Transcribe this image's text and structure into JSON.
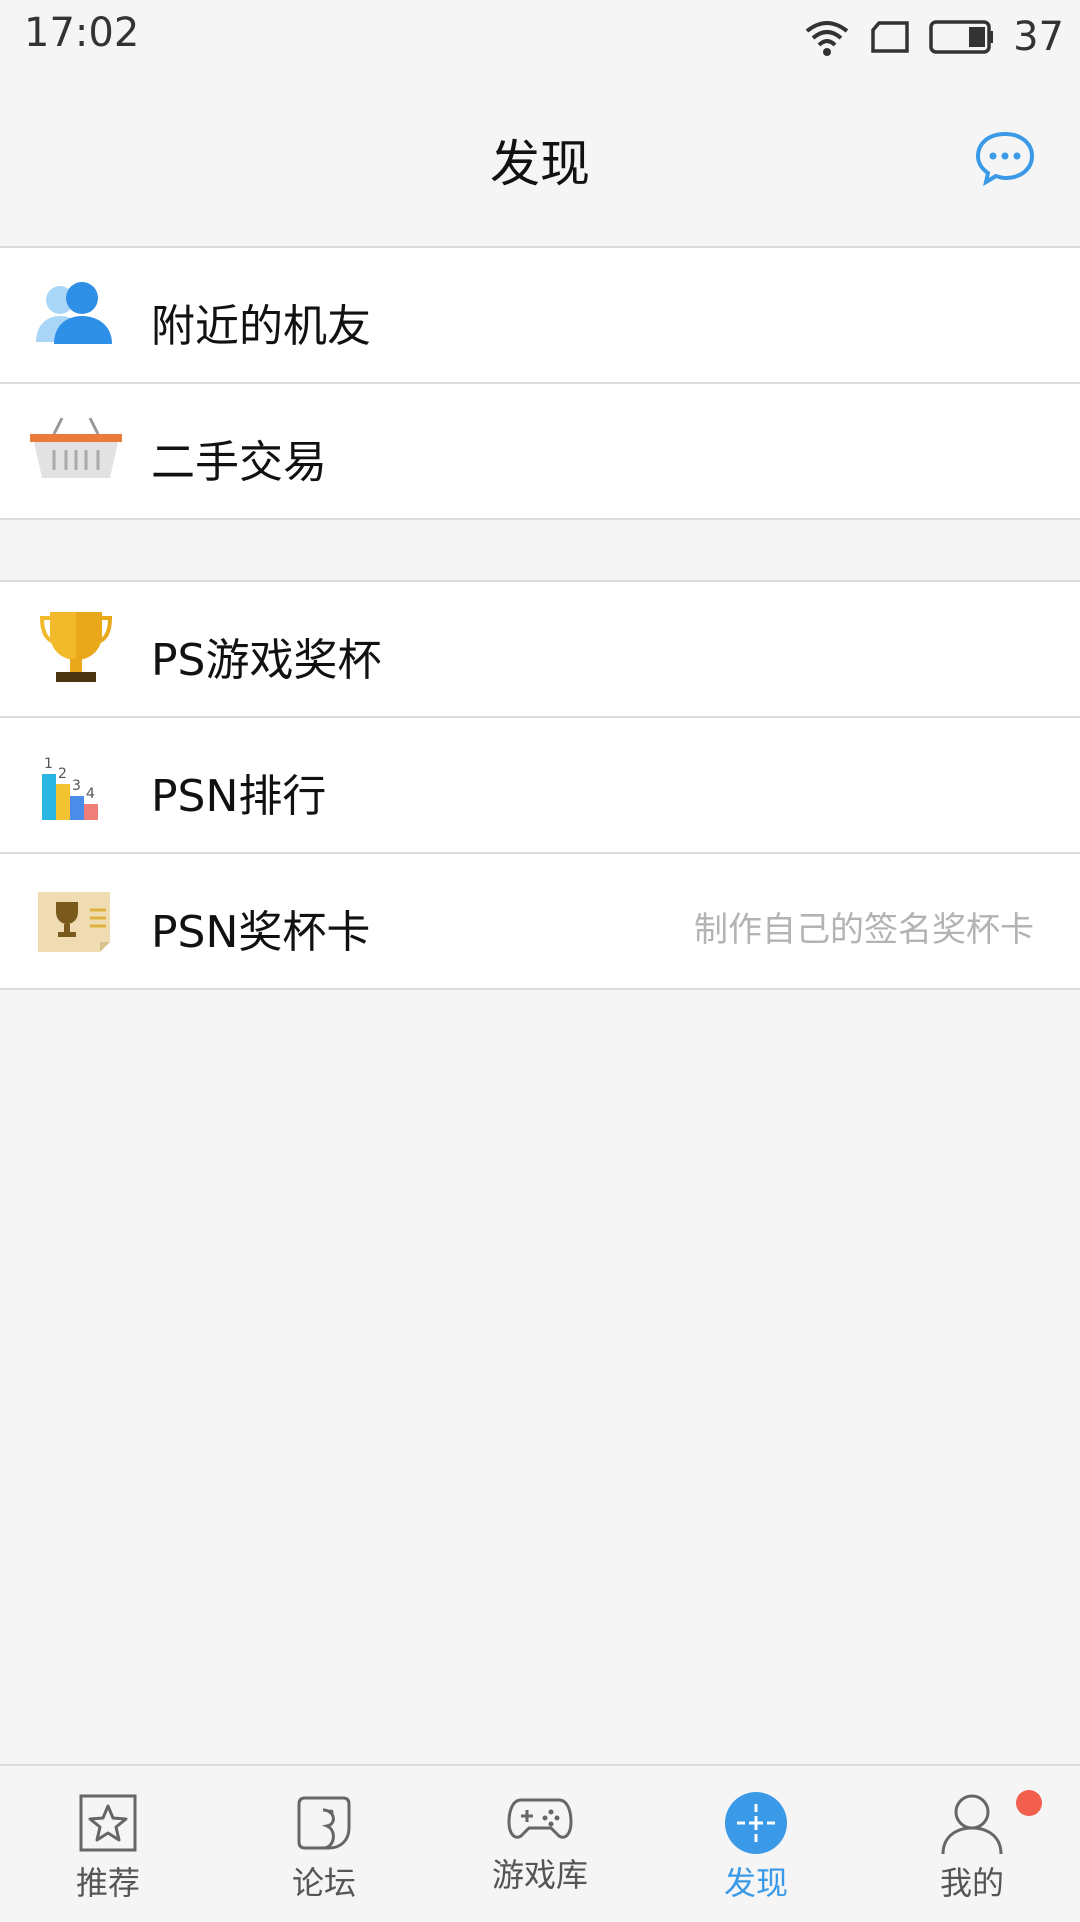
{
  "status": {
    "time": "17:02",
    "battery": "37"
  },
  "header": {
    "title": "发现"
  },
  "sections": [
    {
      "items": [
        {
          "label": "附近的机友",
          "icon": "people-icon"
        },
        {
          "label": "二手交易",
          "icon": "basket-icon"
        }
      ]
    },
    {
      "items": [
        {
          "label": "PS游戏奖杯",
          "icon": "trophy-icon"
        },
        {
          "label": "PSN排行",
          "icon": "ranking-chart-icon"
        },
        {
          "label": "PSN奖杯卡",
          "icon": "trophy-card-icon",
          "hint": "制作自己的签名奖杯卡"
        }
      ]
    }
  ],
  "bottom_nav": [
    {
      "label": "推荐",
      "icon": "star-icon",
      "active": false
    },
    {
      "label": "论坛",
      "icon": "forum-icon",
      "active": false
    },
    {
      "label": "游戏库",
      "icon": "gamepad-icon",
      "active": false
    },
    {
      "label": "发现",
      "icon": "discover-icon",
      "active": true
    },
    {
      "label": "我的",
      "icon": "user-icon",
      "active": false
    }
  ],
  "colors": {
    "accent": "#3a9ae8",
    "badge": "#f25f4d",
    "hint": "#b3b3b3"
  }
}
